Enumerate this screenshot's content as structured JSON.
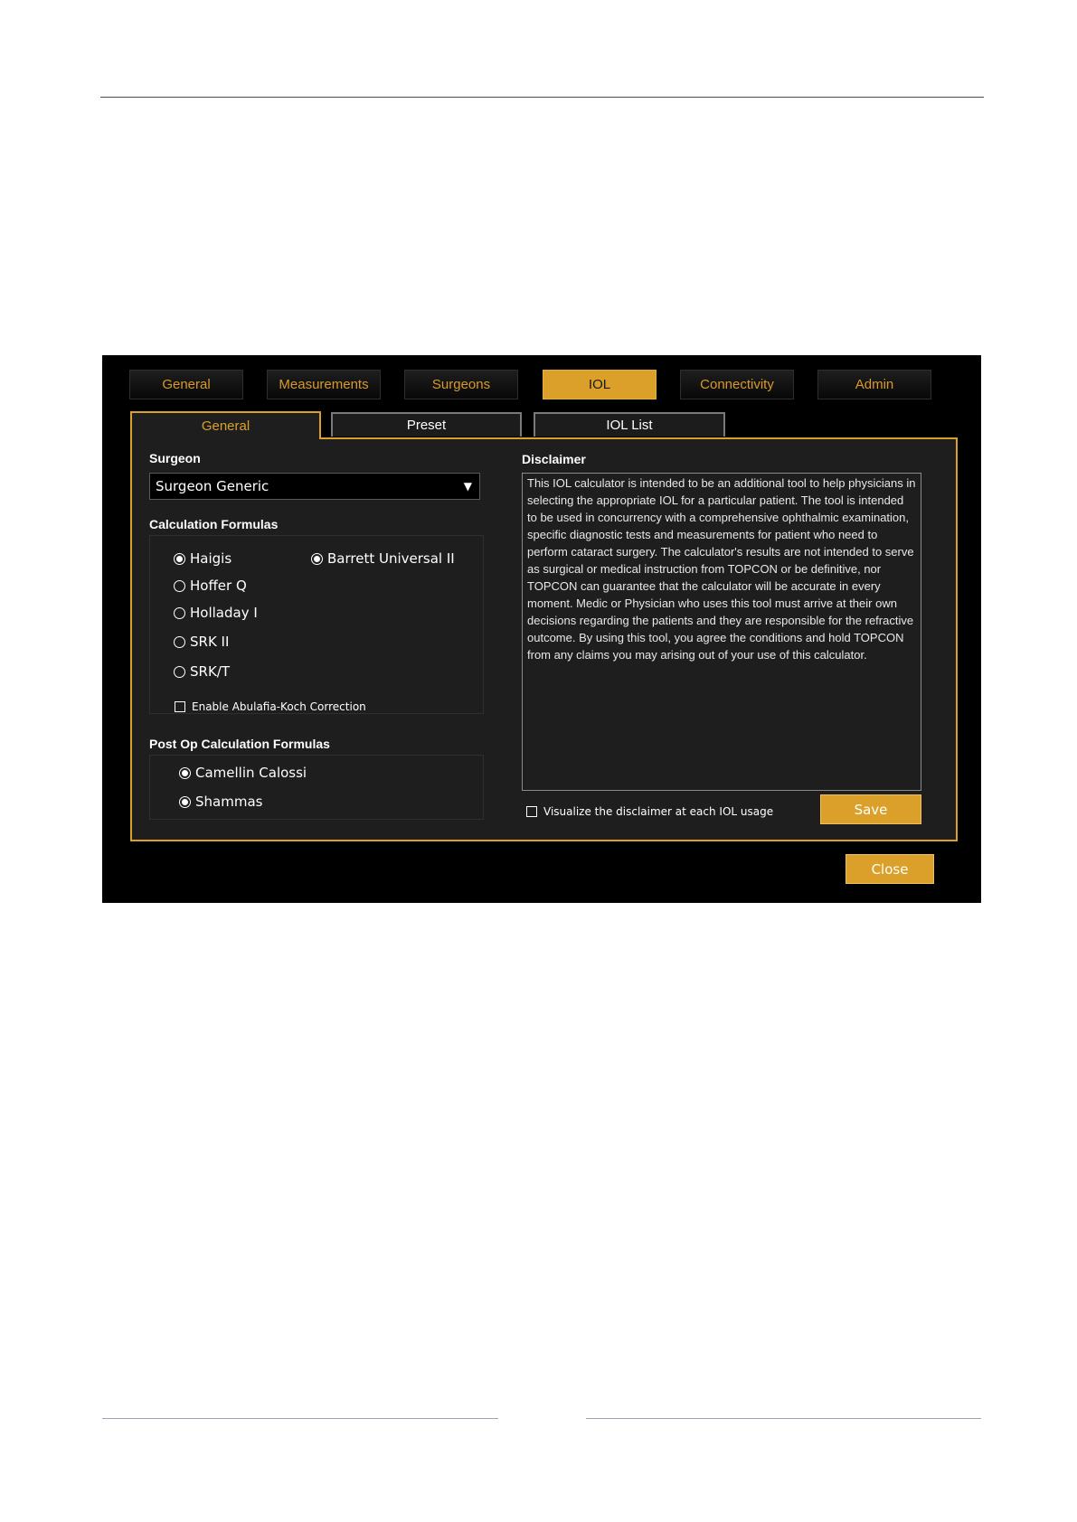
{
  "top_tabs": [
    {
      "label": "General",
      "active": false
    },
    {
      "label": "Measurements",
      "active": false
    },
    {
      "label": "Surgeons",
      "active": false
    },
    {
      "label": "IOL",
      "active": true
    },
    {
      "label": "Connectivity",
      "active": false
    },
    {
      "label": "Admin",
      "active": false
    }
  ],
  "sub_tabs": [
    {
      "label": "General",
      "active": true
    },
    {
      "label": "Preset",
      "active": false
    },
    {
      "label": "IOL List",
      "active": false
    }
  ],
  "surgeon": {
    "label": "Surgeon",
    "selected": "Surgeon Generic"
  },
  "calculation_formulas": {
    "title": "Calculation Formulas",
    "options": [
      {
        "label": "Haigis",
        "selected": true
      },
      {
        "label": "Barrett Universal II",
        "selected": true
      },
      {
        "label": "Hoffer Q",
        "selected": false
      },
      {
        "label": "Holladay I",
        "selected": false
      },
      {
        "label": "SRK II",
        "selected": false
      },
      {
        "label": "SRK/T",
        "selected": false
      }
    ],
    "abulafia_koch": {
      "label": "Enable Abulafia-Koch Correction",
      "checked": false
    }
  },
  "post_op_formulas": {
    "title": "Post Op Calculation Formulas",
    "options": [
      {
        "label": "Camellin Calossi",
        "selected": true
      },
      {
        "label": "Shammas",
        "selected": true
      }
    ]
  },
  "disclaimer": {
    "title": "Disclaimer",
    "text": "This IOL calculator is intended to be an additional tool to help physicians in selecting the appropriate IOL for a particular patient. The tool is intended to be used in concurrency with a comprehensive ophthalmic examination, specific diagnostic tests and measurements for patient who need to perform cataract surgery. The calculator's results are not intended to serve as surgical or medical instruction from TOPCON or be definitive, nor TOPCON can guarantee that the calculator will be accurate in every moment. Medic or Physician who uses this tool must arrive at their own decisions regarding the patients and they are responsible for the refractive outcome. By using this tool, you agree the conditions and hold TOPCON from any claims you may arising out of your use of this calculator.",
    "visualize_label": "Visualize the disclaimer at each IOL usage",
    "visualize_checked": false
  },
  "buttons": {
    "save": "Save",
    "close": "Close"
  },
  "colors": {
    "accent": "#daa02a",
    "background": "#000000",
    "panel": "#1e1e1e"
  }
}
